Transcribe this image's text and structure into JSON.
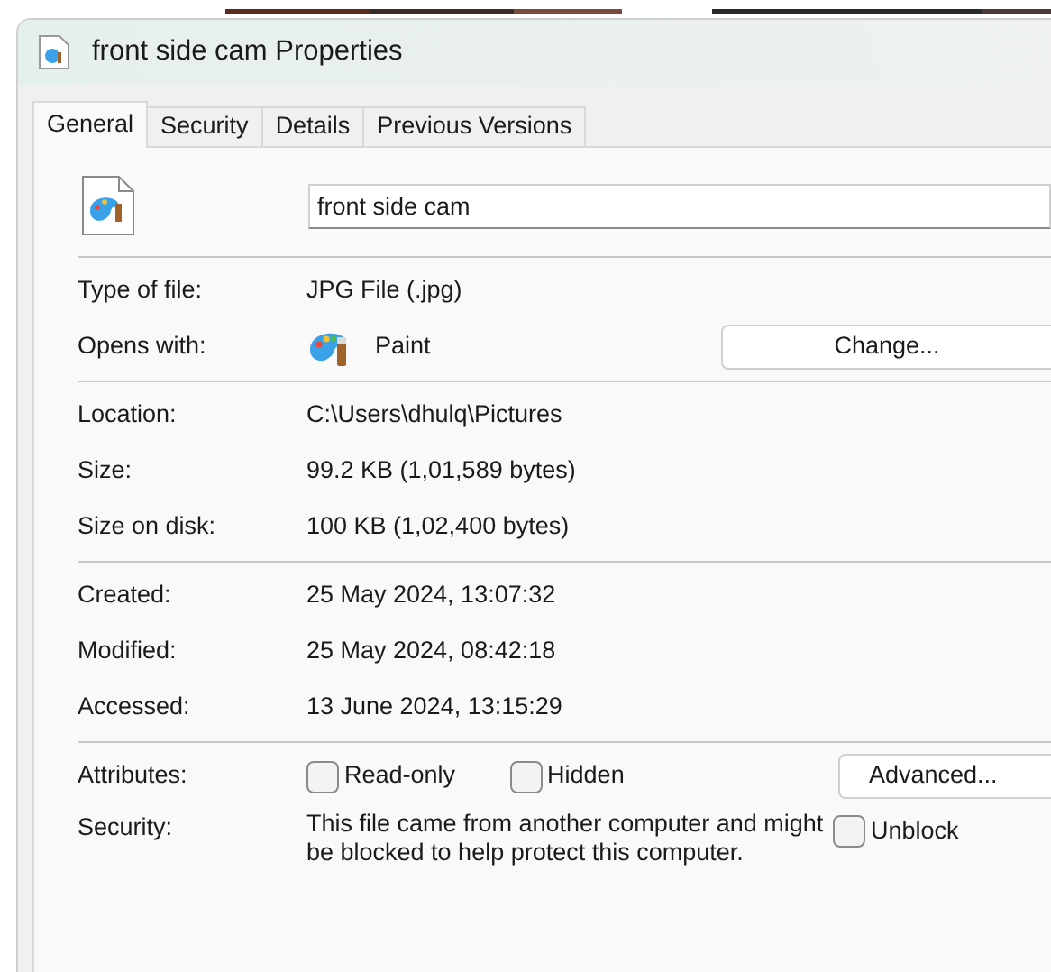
{
  "window": {
    "title": "front side cam Properties"
  },
  "tabs": [
    {
      "label": "General",
      "selected": true
    },
    {
      "label": "Security",
      "selected": false
    },
    {
      "label": "Details",
      "selected": false
    },
    {
      "label": "Previous Versions",
      "selected": false
    }
  ],
  "file_name": "front side cam",
  "file_type": {
    "label": "Type of file:",
    "value": "JPG File (.jpg)"
  },
  "opens_with": {
    "label": "Opens with:",
    "value": "Paint",
    "button": "Change..."
  },
  "location_group": [
    {
      "label": "Location:",
      "value": "C:\\Users\\dhulq\\Pictures"
    },
    {
      "label": "Size:",
      "value": "99.2 KB (1,01,589 bytes)"
    },
    {
      "label": "Size on disk:",
      "value": "100 KB (1,02,400 bytes)"
    }
  ],
  "dates_group": [
    {
      "label": "Created:",
      "value": "25 May 2024, 13:07:32"
    },
    {
      "label": "Modified:",
      "value": "25 May 2024, 08:42:18"
    },
    {
      "label": "Accessed:",
      "value": "13 June 2024, 13:15:29"
    }
  ],
  "attributes": {
    "label": "Attributes:",
    "options": [
      {
        "label": "Read-only",
        "checked": false
      },
      {
        "label": "Hidden",
        "checked": false
      }
    ],
    "button": "Advanced..."
  },
  "security": {
    "label": "Security:",
    "message": "This file came from another computer and might be blocked to help protect this computer.",
    "unblock": {
      "label": "Unblock",
      "checked": false
    }
  }
}
